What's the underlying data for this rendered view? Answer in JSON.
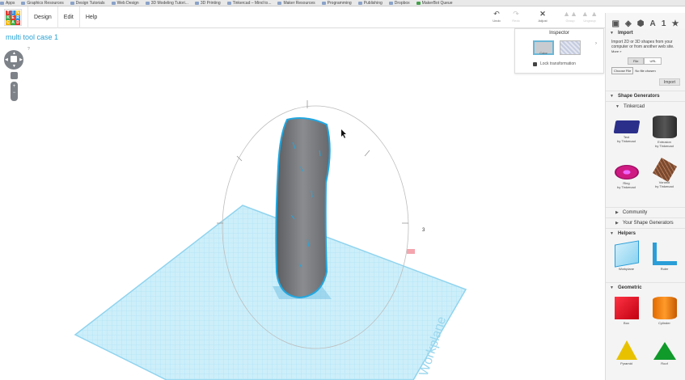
{
  "bookmarks": [
    {
      "label": "Apps"
    },
    {
      "label": "Graphics Resources"
    },
    {
      "label": "Design Tutorials"
    },
    {
      "label": "Web Design"
    },
    {
      "label": "3D Modeling Tutori..."
    },
    {
      "label": "3D Printing"
    },
    {
      "label": "Tinkercad – Mind to..."
    },
    {
      "label": "Maker Resources"
    },
    {
      "label": "Programming"
    },
    {
      "label": "Publishing"
    },
    {
      "label": "Dropbox"
    },
    {
      "label": "MakerBot Queue"
    }
  ],
  "logo": {
    "letters": [
      "T",
      "I",
      "N",
      "K",
      "E",
      "R",
      "C",
      "A",
      "D"
    ],
    "colors": [
      "#e23a2e",
      "#3c8fd8",
      "#f4b400",
      "#39a948",
      "#e23a2e",
      "#3c8fd8",
      "#f4b400",
      "#39a948",
      "#e23a2e"
    ]
  },
  "menu": [
    "Design",
    "Edit",
    "Help"
  ],
  "toolbar": {
    "undo": {
      "icon": "undo-icon",
      "label": "Undo"
    },
    "redo": {
      "icon": "redo-icon",
      "label": "Redo"
    },
    "adjust": {
      "icon": "adjust-icon",
      "label": "Adjust"
    },
    "group": {
      "icon": "group-icon",
      "label": "Group"
    },
    "ungroup": {
      "icon": "ungroup-icon",
      "label": "Ungroup"
    }
  },
  "rightbar": {
    "icons": [
      "box-view-icon",
      "cube-icon",
      "cube-solid-icon",
      "text-icon",
      "number-icon",
      "star-icon"
    ],
    "glyphs": [
      "▣",
      "◈",
      "⬢",
      "A",
      "1",
      "★"
    ]
  },
  "design_title": "multi tool case 1",
  "nav_help": "?",
  "inspector": {
    "title": "Inspector",
    "color_label": "Color",
    "lock_label": "Lock transformation"
  },
  "ruler_label": "3",
  "workplane_label": "Workplane",
  "panel": {
    "import": {
      "title": "Import",
      "description": "Import 2D or 3D shapes from your computer or from another web site.",
      "more": "More »",
      "tabs": [
        "File",
        "URL"
      ],
      "choose_file": "Choose File",
      "no_file": "No file chosen",
      "button": "Import"
    },
    "shape_generators": {
      "title": "Shape Generators",
      "tinkercad": "Tinkercad",
      "items": [
        {
          "name": "Text",
          "by": "by Tinkercad",
          "shape": "text"
        },
        {
          "name": "Extrusion",
          "by": "by Tinkercad",
          "shape": "extr"
        },
        {
          "name": "Ring",
          "by": "by Tinkercad",
          "shape": "ring"
        },
        {
          "name": "Voronoi",
          "by": "by Tinkercad",
          "shape": "voro"
        }
      ],
      "community": "Community",
      "your": "Your Shape Generators"
    },
    "helpers": {
      "title": "Helpers",
      "items": [
        {
          "name": "Workplane",
          "shape": "wp"
        },
        {
          "name": "Ruler",
          "shape": "ruler"
        }
      ]
    },
    "geometric": {
      "title": "Geometric",
      "items": [
        {
          "name": "Box",
          "shape": "box"
        },
        {
          "name": "Cylinder",
          "shape": "cyl"
        },
        {
          "name": "Pyramid",
          "shape": "pyr"
        },
        {
          "name": "Roof",
          "shape": "roof"
        }
      ]
    }
  }
}
